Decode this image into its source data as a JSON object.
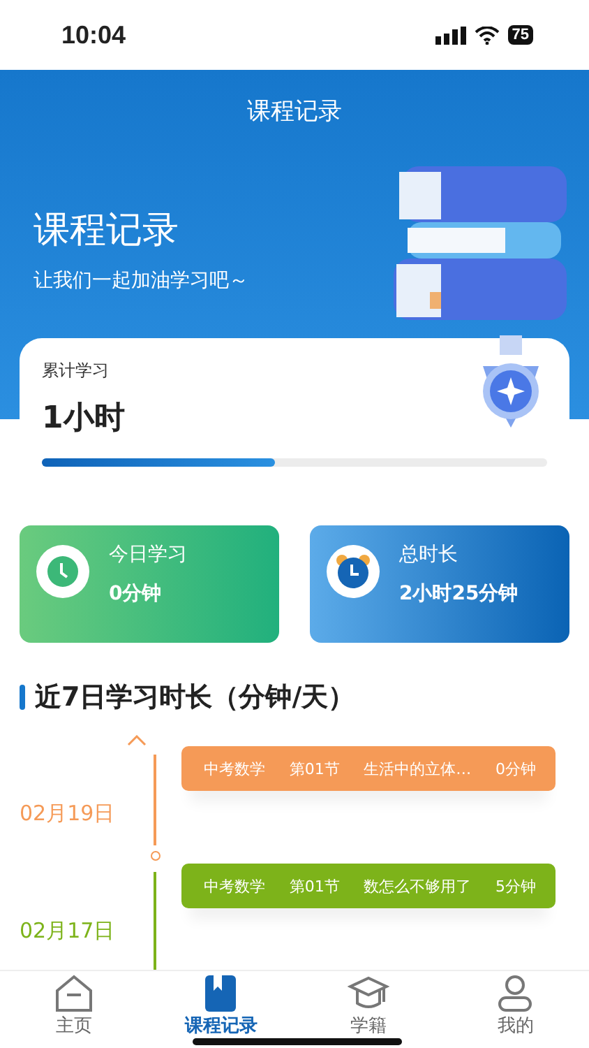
{
  "status_bar": {
    "time": "10:04",
    "battery": "75"
  },
  "header": {
    "title": "课程记录",
    "hero_title": "课程记录",
    "hero_subtitle": "让我们一起加油学习吧～"
  },
  "total_card": {
    "label": "累计学习",
    "value": "1小时",
    "level": 0.46
  },
  "stats": [
    {
      "kind": "today",
      "label": "今日学习",
      "value": "0分钟"
    },
    {
      "kind": "total",
      "label": "总时长",
      "value": "2小时25分钟"
    }
  ],
  "section_title": "近7日学习时长（分钟/天）",
  "timeline": [
    {
      "date": "02月19日",
      "color": "#f59a57",
      "subject": "中考数学",
      "lesson": "第01节",
      "title": "生活中的立体…",
      "duration": "0分钟"
    },
    {
      "date": "02月17日",
      "color": "#7db31a",
      "subject": "中考数学",
      "lesson": "第01节",
      "title": "数怎么不够用了",
      "duration": "5分钟"
    }
  ],
  "tabs": [
    {
      "kind": "home",
      "label": "主页",
      "selected": false
    },
    {
      "kind": "record",
      "label": "课程记录",
      "selected": true
    },
    {
      "kind": "study",
      "label": "学籍",
      "selected": false
    },
    {
      "kind": "me",
      "label": "我的",
      "selected": false
    }
  ]
}
